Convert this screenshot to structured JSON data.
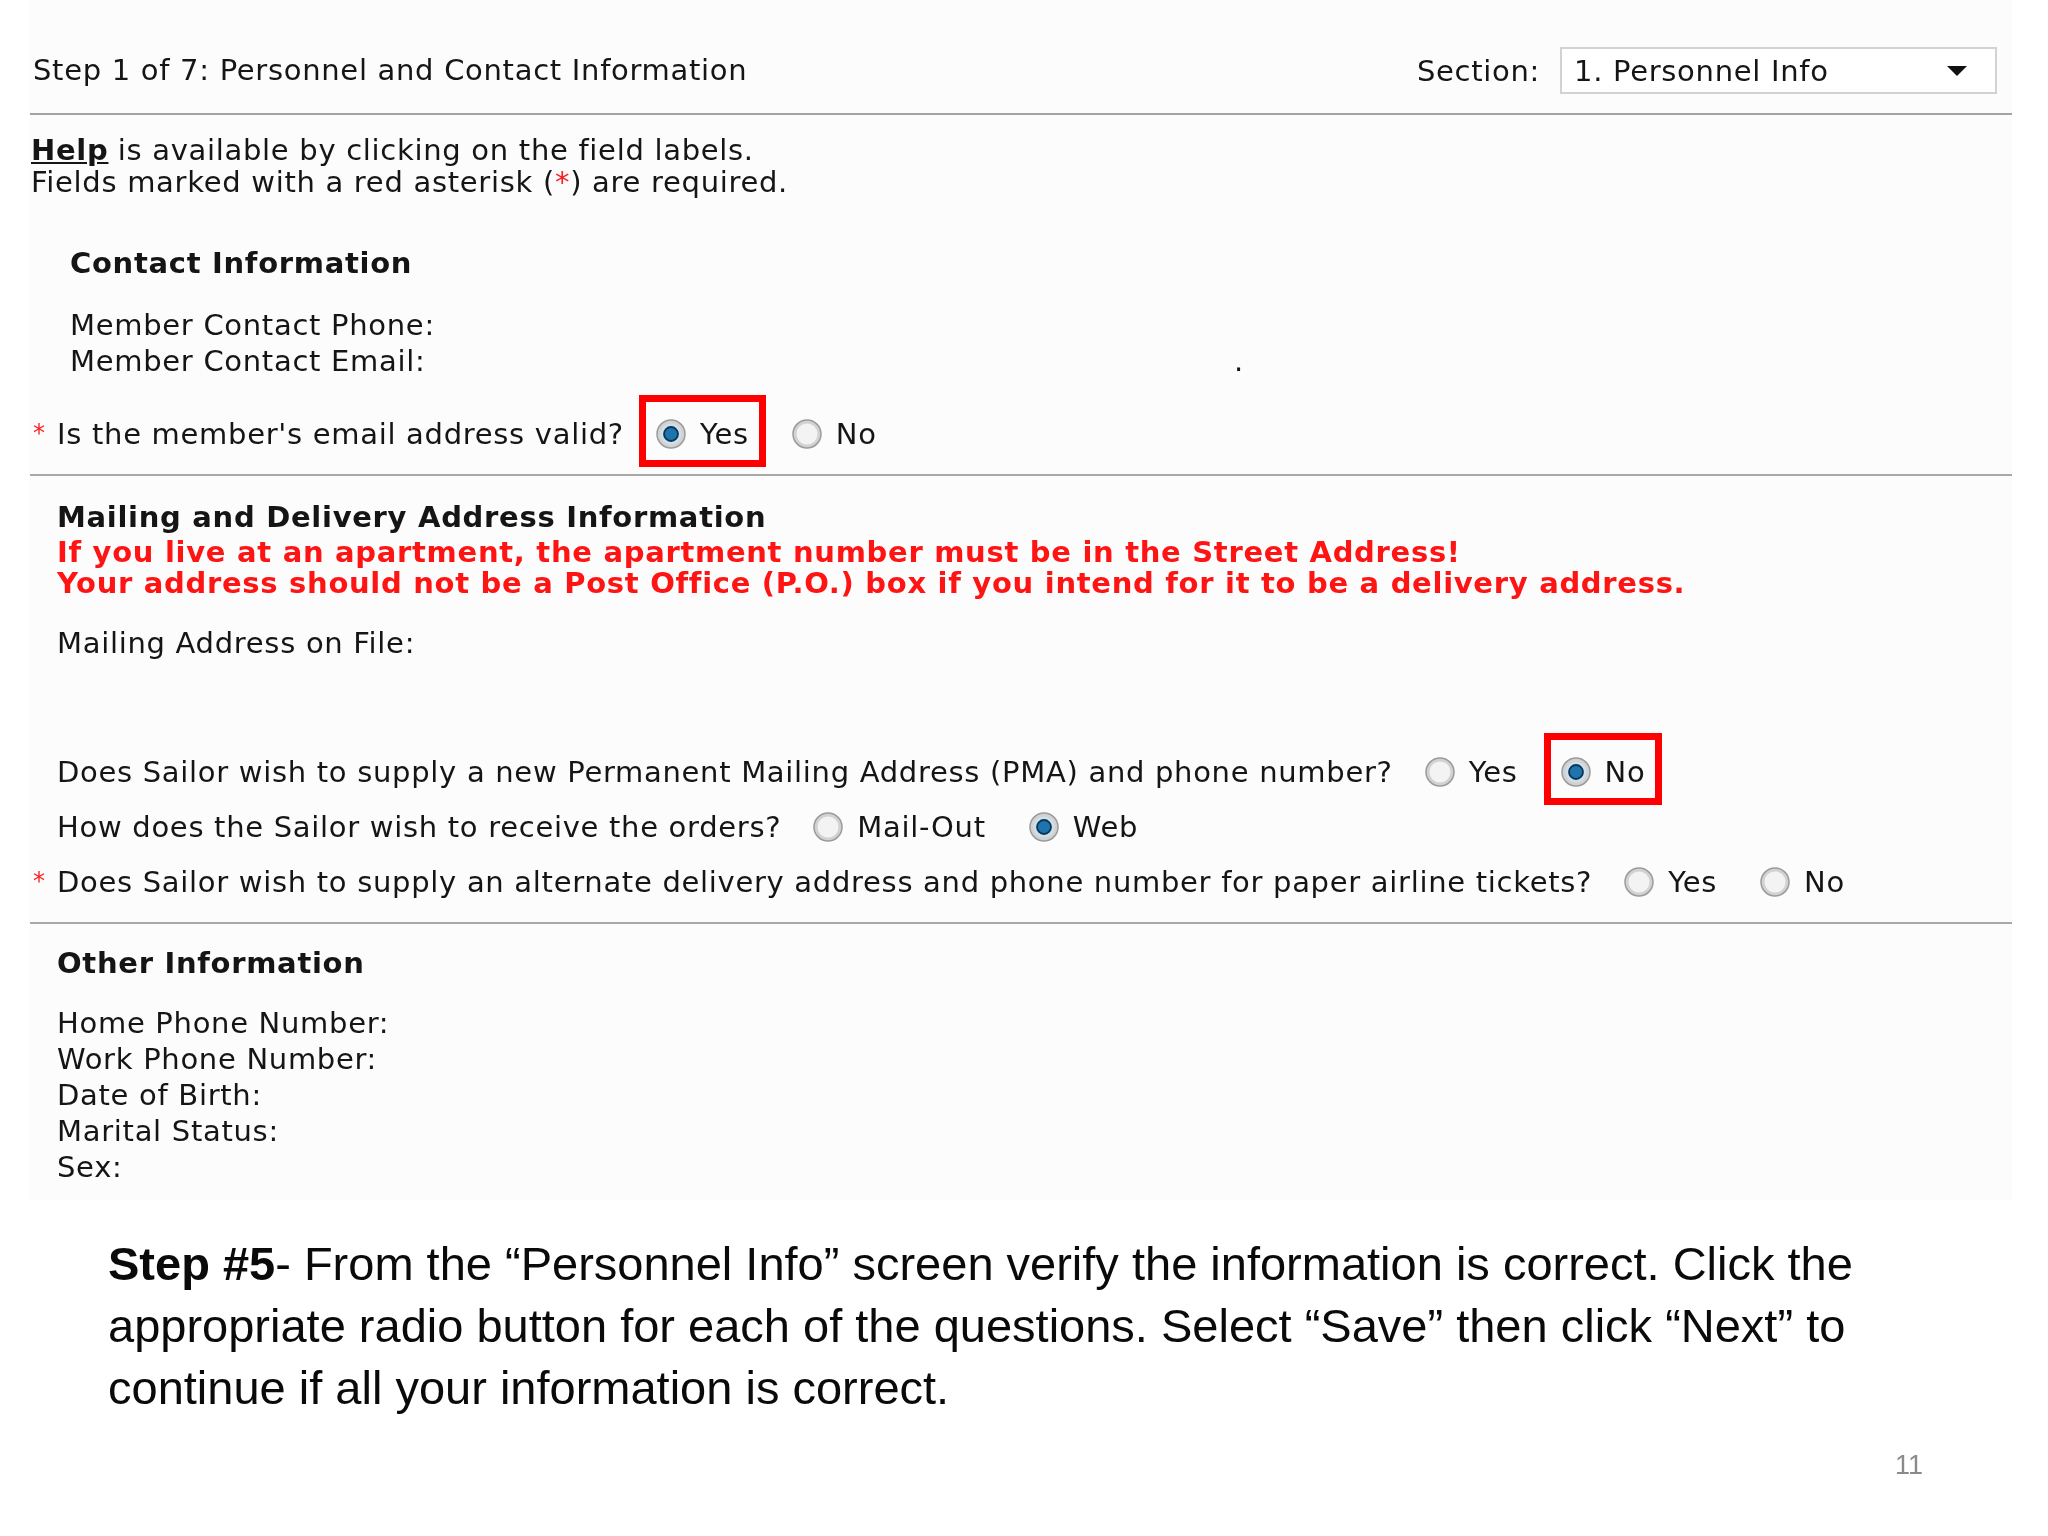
{
  "header": {
    "title": "Step 1 of 7: Personnel and Contact Information",
    "section_label": "Section:",
    "section_dropdown": {
      "value": "1. Personnel Info"
    }
  },
  "notes": {
    "help_link": "Help",
    "help_text": "is available by clicking on the field labels.",
    "required_note": {
      "before": "Fields marked with a red asterisk (",
      "mark": "*",
      "after": ") are required."
    }
  },
  "contact": {
    "heading": "Contact Information",
    "fields": [
      {
        "label": "Member Contact Phone:"
      },
      {
        "label": "Member Contact Email:",
        "value": "."
      }
    ],
    "questions": [
      {
        "required_mark": "*",
        "text": "Is the member's email address valid?",
        "highlighted": true,
        "options": [
          {
            "label": "Yes",
            "selected": true
          },
          {
            "label": "No",
            "selected": false
          }
        ]
      }
    ]
  },
  "mailing": {
    "heading": "Mailing and Delivery Address Information",
    "warnings": [
      "If you live at an apartment, the apartment number must be in the Street Address!",
      "Your address should not be a Post Office (P.O.) box if you intend for it to be a delivery address."
    ],
    "fields": [
      {
        "label": "Mailing Address on File:"
      }
    ],
    "questions": [
      {
        "text": "Does Sailor wish to supply a new Permanent Mailing Address (PMA) and phone number?",
        "highlighted": true,
        "options": [
          {
            "label": "Yes",
            "selected": false
          },
          {
            "label": "No",
            "selected": true
          }
        ]
      },
      {
        "text": "How does the Sailor wish to receive the orders?",
        "highlighted": false,
        "options": [
          {
            "label": "Mail-Out",
            "selected": false
          },
          {
            "label": "Web",
            "selected": true
          }
        ]
      },
      {
        "required_mark": "*",
        "text": "Does Sailor wish to supply an alternate delivery address and phone number for paper airline tickets?",
        "highlighted": false,
        "options": [
          {
            "label": "Yes",
            "selected": false
          },
          {
            "label": "No",
            "selected": false
          }
        ]
      }
    ]
  },
  "other": {
    "heading": "Other Information",
    "fields": [
      {
        "label": "Home Phone Number:"
      },
      {
        "label": "Work Phone Number:"
      },
      {
        "label": "Date of Birth:"
      },
      {
        "label": "Marital Status:"
      },
      {
        "label": "Sex:"
      }
    ]
  },
  "caption": "**Step #5**- From the “Personnel Info” screen verify the information is correct. Click the appropriate radio button for each of the questions. Select “Save” then click “Next” to continue if all your information is correct.",
  "page_number": "11"
}
